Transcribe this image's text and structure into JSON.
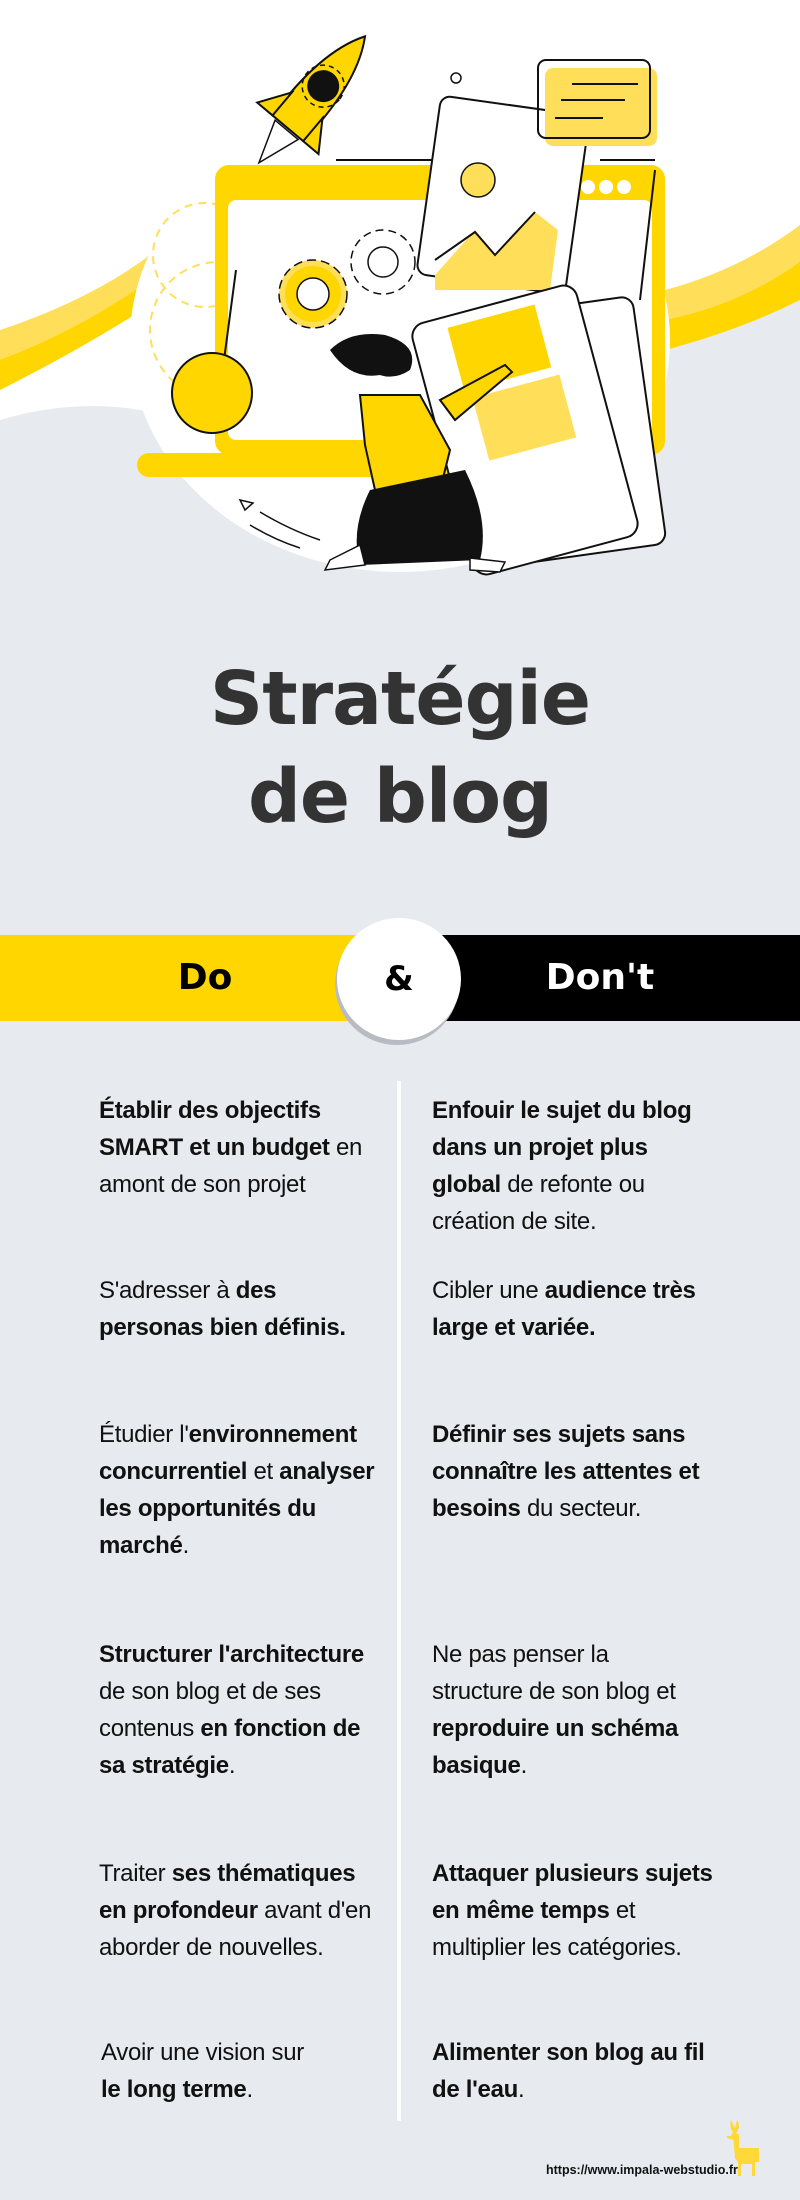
{
  "title": {
    "line1": "Stratégie",
    "line2": "de blog"
  },
  "banner": {
    "do_label": "Do",
    "ampersand": "&",
    "dont_label": "Don't"
  },
  "colors": {
    "accent_yellow": "#ffd600",
    "light_yellow": "#ffdf5a",
    "background": "#e7eaee",
    "text_dark": "#333333",
    "black": "#000000"
  },
  "rows": [
    {
      "do": [
        {
          "t": "Établir des objectifs",
          "b": true
        },
        {
          "t": "\n"
        },
        {
          "t": "SMART et un budget",
          "b": true
        },
        {
          "t": " en"
        },
        {
          "t": "\n"
        },
        {
          "t": "amont de son projet"
        }
      ],
      "dont": [
        {
          "t": "Enfouir le sujet du blog",
          "b": true
        },
        {
          "t": "\n"
        },
        {
          "t": "dans un projet plus",
          "b": true
        },
        {
          "t": "\n"
        },
        {
          "t": "global",
          "b": true
        },
        {
          "t": " de refonte ou"
        },
        {
          "t": "\n"
        },
        {
          "t": "création de site."
        }
      ]
    },
    {
      "do": [
        {
          "t": "S'adresser à "
        },
        {
          "t": "des",
          "b": true
        },
        {
          "t": "\n"
        },
        {
          "t": "personas bien définis.",
          "b": true
        }
      ],
      "dont": [
        {
          "t": "Cibler une "
        },
        {
          "t": "audience très",
          "b": true
        },
        {
          "t": "\n"
        },
        {
          "t": "large et variée.",
          "b": true
        }
      ]
    },
    {
      "do": [
        {
          "t": "Étudier l'"
        },
        {
          "t": "environnement",
          "b": true
        },
        {
          "t": "\n"
        },
        {
          "t": "concurrentiel",
          "b": true
        },
        {
          "t": " et "
        },
        {
          "t": "analyser",
          "b": true
        },
        {
          "t": "\n"
        },
        {
          "t": "les opportunités du",
          "b": true
        },
        {
          "t": "\n"
        },
        {
          "t": "marché",
          "b": true
        },
        {
          "t": "."
        }
      ],
      "dont": [
        {
          "t": "Définir ses sujets sans",
          "b": true
        },
        {
          "t": "\n"
        },
        {
          "t": "connaître les attentes et",
          "b": true
        },
        {
          "t": "\n"
        },
        {
          "t": "besoins",
          "b": true
        },
        {
          "t": " du secteur."
        }
      ]
    },
    {
      "do": [
        {
          "t": "Structurer l'architecture",
          "b": true
        },
        {
          "t": "\n"
        },
        {
          "t": "de son blog et de ses"
        },
        {
          "t": "\n"
        },
        {
          "t": "contenus "
        },
        {
          "t": "en fonction de",
          "b": true
        },
        {
          "t": "\n"
        },
        {
          "t": "sa stratégie",
          "b": true
        },
        {
          "t": "."
        }
      ],
      "dont": [
        {
          "t": "Ne pas penser la"
        },
        {
          "t": "\n"
        },
        {
          "t": "structure de son blog et"
        },
        {
          "t": "\n"
        },
        {
          "t": "reproduire un schéma",
          "b": true
        },
        {
          "t": "\n"
        },
        {
          "t": "basique",
          "b": true
        },
        {
          "t": "."
        }
      ]
    },
    {
      "do": [
        {
          "t": "Traiter "
        },
        {
          "t": "ses thématiques",
          "b": true
        },
        {
          "t": "\n"
        },
        {
          "t": "en profondeur",
          "b": true
        },
        {
          "t": " avant d'en"
        },
        {
          "t": "\n"
        },
        {
          "t": "aborder de nouvelles."
        }
      ],
      "dont": [
        {
          "t": "Attaquer plusieurs sujets",
          "b": true
        },
        {
          "t": "\n"
        },
        {
          "t": "en même temps",
          "b": true
        },
        {
          "t": " et"
        },
        {
          "t": "\n"
        },
        {
          "t": "multiplier les catégories."
        }
      ]
    },
    {
      "do": [
        {
          "t": "Avoir une vision sur"
        },
        {
          "t": "\n"
        },
        {
          "t": "le long terme",
          "b": true
        },
        {
          "t": "."
        }
      ],
      "dont": [
        {
          "t": "Alimenter son blog au fil",
          "b": true
        },
        {
          "t": "\n"
        },
        {
          "t": "de l'eau",
          "b": true
        },
        {
          "t": "."
        }
      ]
    }
  ],
  "footer": {
    "url": "https://www.impala-webstudio.fr",
    "logo_icon": "impala-deer-icon"
  },
  "illustration": {
    "subject": "woman-building-website-illustration",
    "icons": [
      "rocket-icon",
      "gear-icon",
      "image-card-icon",
      "text-card-icon",
      "browser-window-icon",
      "mobile-screen-icon"
    ]
  }
}
